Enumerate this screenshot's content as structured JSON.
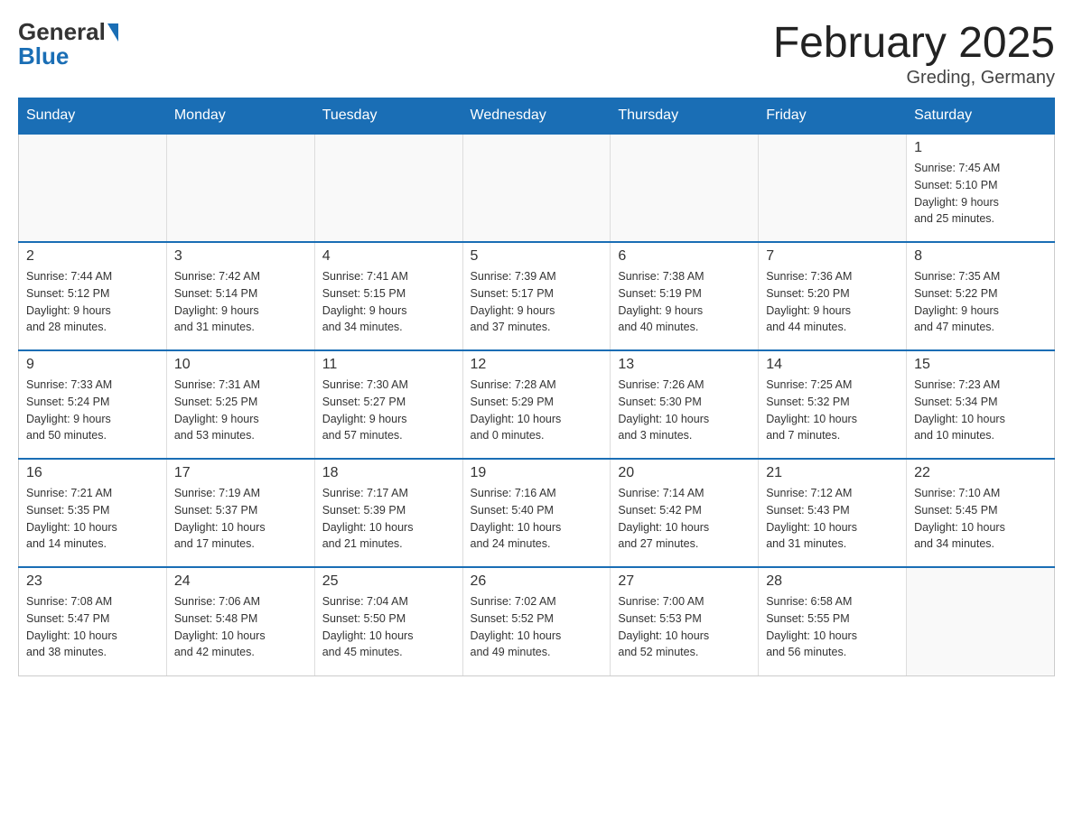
{
  "header": {
    "logo_line1": "General",
    "logo_line2": "Blue",
    "month_year": "February 2025",
    "location": "Greding, Germany"
  },
  "days_of_week": [
    "Sunday",
    "Monday",
    "Tuesday",
    "Wednesday",
    "Thursday",
    "Friday",
    "Saturday"
  ],
  "weeks": [
    {
      "days": [
        {
          "num": "",
          "info": "",
          "empty": true
        },
        {
          "num": "",
          "info": "",
          "empty": true
        },
        {
          "num": "",
          "info": "",
          "empty": true
        },
        {
          "num": "",
          "info": "",
          "empty": true
        },
        {
          "num": "",
          "info": "",
          "empty": true
        },
        {
          "num": "",
          "info": "",
          "empty": true
        },
        {
          "num": "1",
          "info": "Sunrise: 7:45 AM\nSunset: 5:10 PM\nDaylight: 9 hours\nand 25 minutes.",
          "empty": false
        }
      ]
    },
    {
      "days": [
        {
          "num": "2",
          "info": "Sunrise: 7:44 AM\nSunset: 5:12 PM\nDaylight: 9 hours\nand 28 minutes.",
          "empty": false
        },
        {
          "num": "3",
          "info": "Sunrise: 7:42 AM\nSunset: 5:14 PM\nDaylight: 9 hours\nand 31 minutes.",
          "empty": false
        },
        {
          "num": "4",
          "info": "Sunrise: 7:41 AM\nSunset: 5:15 PM\nDaylight: 9 hours\nand 34 minutes.",
          "empty": false
        },
        {
          "num": "5",
          "info": "Sunrise: 7:39 AM\nSunset: 5:17 PM\nDaylight: 9 hours\nand 37 minutes.",
          "empty": false
        },
        {
          "num": "6",
          "info": "Sunrise: 7:38 AM\nSunset: 5:19 PM\nDaylight: 9 hours\nand 40 minutes.",
          "empty": false
        },
        {
          "num": "7",
          "info": "Sunrise: 7:36 AM\nSunset: 5:20 PM\nDaylight: 9 hours\nand 44 minutes.",
          "empty": false
        },
        {
          "num": "8",
          "info": "Sunrise: 7:35 AM\nSunset: 5:22 PM\nDaylight: 9 hours\nand 47 minutes.",
          "empty": false
        }
      ]
    },
    {
      "days": [
        {
          "num": "9",
          "info": "Sunrise: 7:33 AM\nSunset: 5:24 PM\nDaylight: 9 hours\nand 50 minutes.",
          "empty": false
        },
        {
          "num": "10",
          "info": "Sunrise: 7:31 AM\nSunset: 5:25 PM\nDaylight: 9 hours\nand 53 minutes.",
          "empty": false
        },
        {
          "num": "11",
          "info": "Sunrise: 7:30 AM\nSunset: 5:27 PM\nDaylight: 9 hours\nand 57 minutes.",
          "empty": false
        },
        {
          "num": "12",
          "info": "Sunrise: 7:28 AM\nSunset: 5:29 PM\nDaylight: 10 hours\nand 0 minutes.",
          "empty": false
        },
        {
          "num": "13",
          "info": "Sunrise: 7:26 AM\nSunset: 5:30 PM\nDaylight: 10 hours\nand 3 minutes.",
          "empty": false
        },
        {
          "num": "14",
          "info": "Sunrise: 7:25 AM\nSunset: 5:32 PM\nDaylight: 10 hours\nand 7 minutes.",
          "empty": false
        },
        {
          "num": "15",
          "info": "Sunrise: 7:23 AM\nSunset: 5:34 PM\nDaylight: 10 hours\nand 10 minutes.",
          "empty": false
        }
      ]
    },
    {
      "days": [
        {
          "num": "16",
          "info": "Sunrise: 7:21 AM\nSunset: 5:35 PM\nDaylight: 10 hours\nand 14 minutes.",
          "empty": false
        },
        {
          "num": "17",
          "info": "Sunrise: 7:19 AM\nSunset: 5:37 PM\nDaylight: 10 hours\nand 17 minutes.",
          "empty": false
        },
        {
          "num": "18",
          "info": "Sunrise: 7:17 AM\nSunset: 5:39 PM\nDaylight: 10 hours\nand 21 minutes.",
          "empty": false
        },
        {
          "num": "19",
          "info": "Sunrise: 7:16 AM\nSunset: 5:40 PM\nDaylight: 10 hours\nand 24 minutes.",
          "empty": false
        },
        {
          "num": "20",
          "info": "Sunrise: 7:14 AM\nSunset: 5:42 PM\nDaylight: 10 hours\nand 27 minutes.",
          "empty": false
        },
        {
          "num": "21",
          "info": "Sunrise: 7:12 AM\nSunset: 5:43 PM\nDaylight: 10 hours\nand 31 minutes.",
          "empty": false
        },
        {
          "num": "22",
          "info": "Sunrise: 7:10 AM\nSunset: 5:45 PM\nDaylight: 10 hours\nand 34 minutes.",
          "empty": false
        }
      ]
    },
    {
      "days": [
        {
          "num": "23",
          "info": "Sunrise: 7:08 AM\nSunset: 5:47 PM\nDaylight: 10 hours\nand 38 minutes.",
          "empty": false
        },
        {
          "num": "24",
          "info": "Sunrise: 7:06 AM\nSunset: 5:48 PM\nDaylight: 10 hours\nand 42 minutes.",
          "empty": false
        },
        {
          "num": "25",
          "info": "Sunrise: 7:04 AM\nSunset: 5:50 PM\nDaylight: 10 hours\nand 45 minutes.",
          "empty": false
        },
        {
          "num": "26",
          "info": "Sunrise: 7:02 AM\nSunset: 5:52 PM\nDaylight: 10 hours\nand 49 minutes.",
          "empty": false
        },
        {
          "num": "27",
          "info": "Sunrise: 7:00 AM\nSunset: 5:53 PM\nDaylight: 10 hours\nand 52 minutes.",
          "empty": false
        },
        {
          "num": "28",
          "info": "Sunrise: 6:58 AM\nSunset: 5:55 PM\nDaylight: 10 hours\nand 56 minutes.",
          "empty": false
        },
        {
          "num": "",
          "info": "",
          "empty": true
        }
      ]
    }
  ]
}
